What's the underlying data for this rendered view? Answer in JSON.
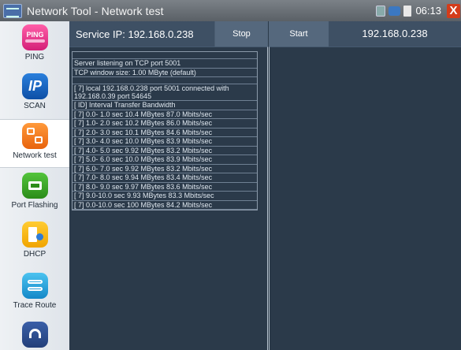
{
  "titlebar": {
    "title": "Network Tool - Network test",
    "time": "06:13",
    "close_label": "X"
  },
  "sidebar": {
    "items": [
      {
        "label": "PING",
        "icon": "ping-icon",
        "icon_text": "PING"
      },
      {
        "label": "SCAN",
        "icon": "scan-icon",
        "icon_text": "IP"
      },
      {
        "label": "Network test",
        "icon": "network-test-icon",
        "active": true
      },
      {
        "label": "Port Flashing",
        "icon": "port-flashing-icon"
      },
      {
        "label": "DHCP",
        "icon": "dhcp-icon"
      },
      {
        "label": "Trace Route",
        "icon": "trace-route-icon"
      }
    ]
  },
  "header": {
    "service_ip": "Service IP: 192.168.0.238",
    "stop_label": "Stop",
    "start_label": "Start",
    "client_ip": "192.168.0.238"
  },
  "log": {
    "lines": [
      "",
      "Server listening on TCP port 5001",
      "TCP window size: 1.00 MByte (default)",
      "",
      "[ 7] local 192.168.0.238 port 5001 connected with 192.168.0.39 port 54645",
      "[ ID] Interval     Transfer     Bandwidth",
      "[ 7]  0.0- 1.0 sec  10.4 MBytes  87.0 Mbits/sec",
      "[ 7]  1.0- 2.0 sec  10.2 MBytes  86.0 Mbits/sec",
      "[ 7]  2.0- 3.0 sec  10.1 MBytes  84.6 Mbits/sec",
      "[ 7]  3.0- 4.0 sec  10.0 MBytes  83.9 Mbits/sec",
      "[ 7]  4.0- 5.0 sec  9.92 MBytes  83.2 Mbits/sec",
      "[ 7]  5.0- 6.0 sec  10.0 MBytes  83.9 Mbits/sec",
      "[ 7]  6.0- 7.0 sec  9.92 MBytes  83.2 Mbits/sec",
      "[ 7]  7.0- 8.0 sec  9.94 MBytes  83.4 Mbits/sec",
      "[ 7]  8.0- 9.0 sec  9.97 MBytes  83.6 Mbits/sec",
      "[ 7]  9.0-10.0 sec  9.93 MBytes  83.3 Mbits/sec",
      "[ 7]  0.0-10.0 sec  100 MBytes  84.2 Mbits/sec"
    ]
  },
  "colors": {
    "titlebar": "#6a7076",
    "panel_bg": "#2b3a4a",
    "header_bg": "#3e5064",
    "button_bg": "#55687d",
    "sidebar_bg": "#e8ecf0",
    "close": "#d43c1a"
  }
}
